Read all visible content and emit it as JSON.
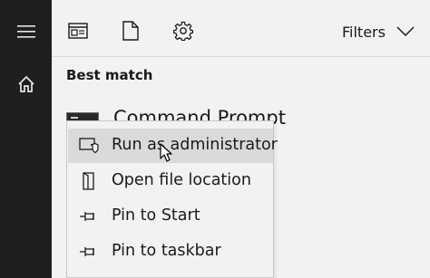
{
  "sidebar": {
    "menu_icon": "hamburger-icon",
    "home_icon": "home-icon"
  },
  "toolbar": {
    "icons": [
      "apps-icon",
      "document-icon",
      "gear-icon"
    ],
    "filters_label": "Filters",
    "filters_icon": "chevron-down-icon"
  },
  "results": {
    "section_title": "Best match",
    "best_match_label": "Command Prompt"
  },
  "context_menu": {
    "items": [
      {
        "label": "Run as administrator",
        "icon": "shield-icon",
        "highlighted": true
      },
      {
        "label": "Open file location",
        "icon": "file-location-icon",
        "highlighted": false
      },
      {
        "label": "Pin to Start",
        "icon": "pin-icon",
        "highlighted": false
      },
      {
        "label": "Pin to taskbar",
        "icon": "pin-icon",
        "highlighted": false
      }
    ]
  },
  "colors": {
    "sidebar_bg": "#1f1f1f",
    "panel_bg": "#f2f2f2",
    "highlight_bg": "#dadada"
  }
}
